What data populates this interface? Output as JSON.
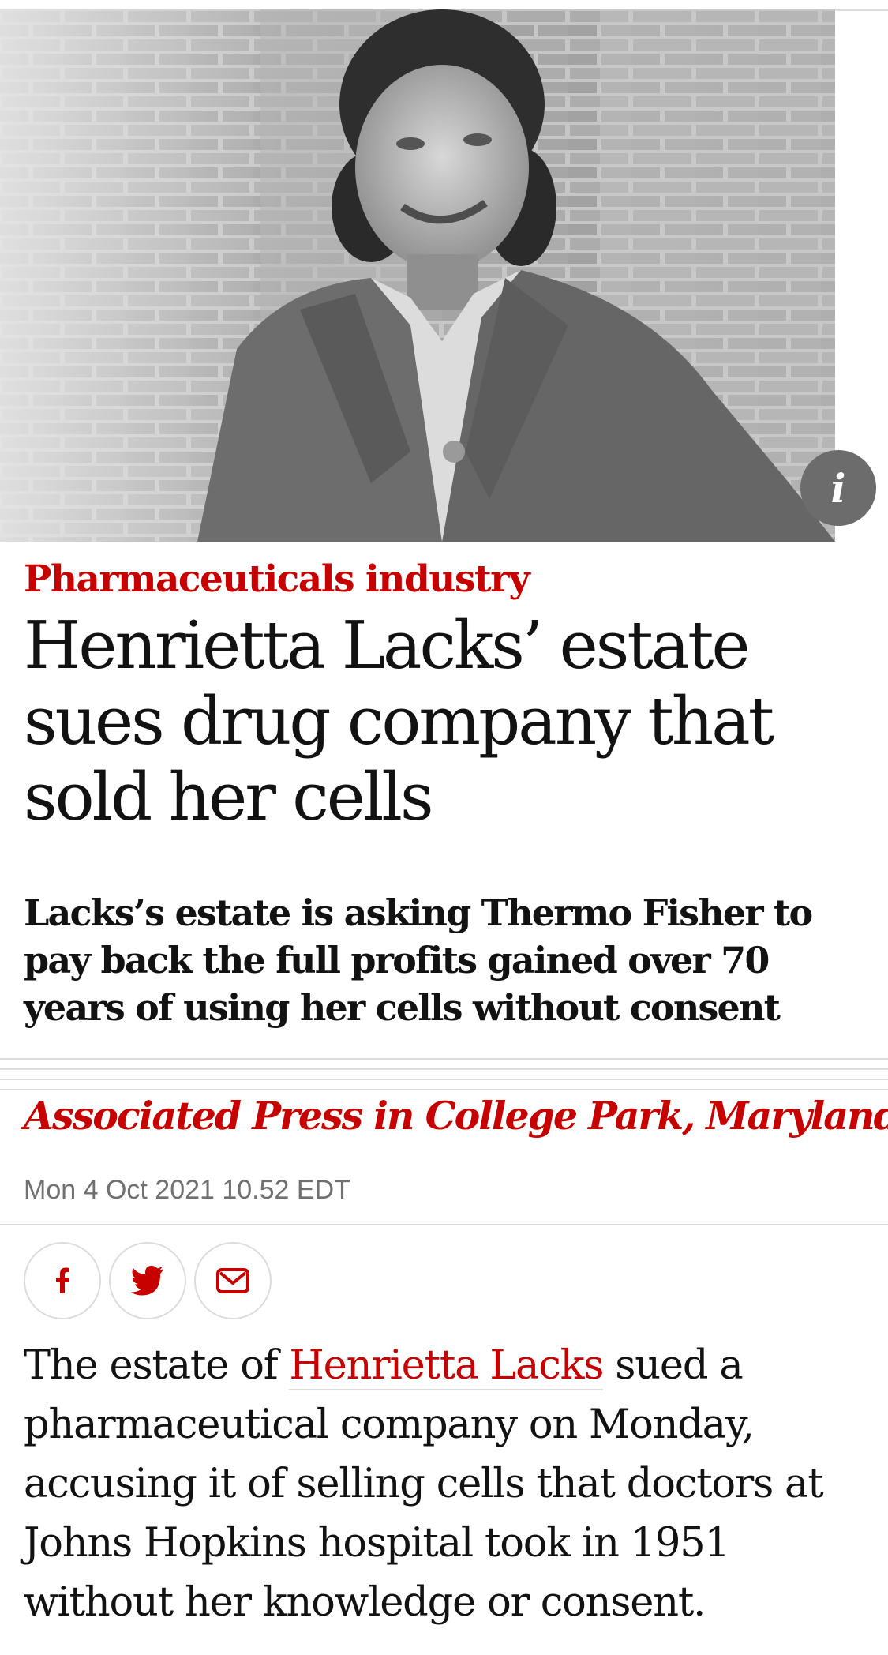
{
  "hero": {
    "image_alt": "Black and white photograph of a woman in a jacket standing in front of a brick wall",
    "info_icon": "info-icon",
    "info_label": "i"
  },
  "article": {
    "kicker": "Pharmaceuticals industry",
    "headline": "Henrietta Lacks’ estate sues drug company that sold her cells",
    "standfirst": "Lacks’s estate is asking Thermo Fisher to pay back the full profits gained over 70 years of using her cells without consent",
    "byline": "Associated Press in College Park, Maryland",
    "dateline": "Mon 4 Oct 2021 10.52 EDT"
  },
  "share": {
    "buttons": [
      {
        "icon": "facebook-icon",
        "label": "Share on Facebook"
      },
      {
        "icon": "twitter-icon",
        "label": "Share on Twitter"
      },
      {
        "icon": "email-icon",
        "label": "Share via Email"
      }
    ]
  },
  "body": {
    "p1_before": "The estate of ",
    "p1_link": "Henrietta Lacks",
    "p1_after": " sued a pharmaceutical company on Monday, accusing it of selling cells that doctors at Johns Hopkins hospital took in 1951 without her knowledge or consent."
  },
  "colors": {
    "accent": "#c70000",
    "text": "#121212",
    "muted": "#707070",
    "rule": "#dcdcdc"
  }
}
